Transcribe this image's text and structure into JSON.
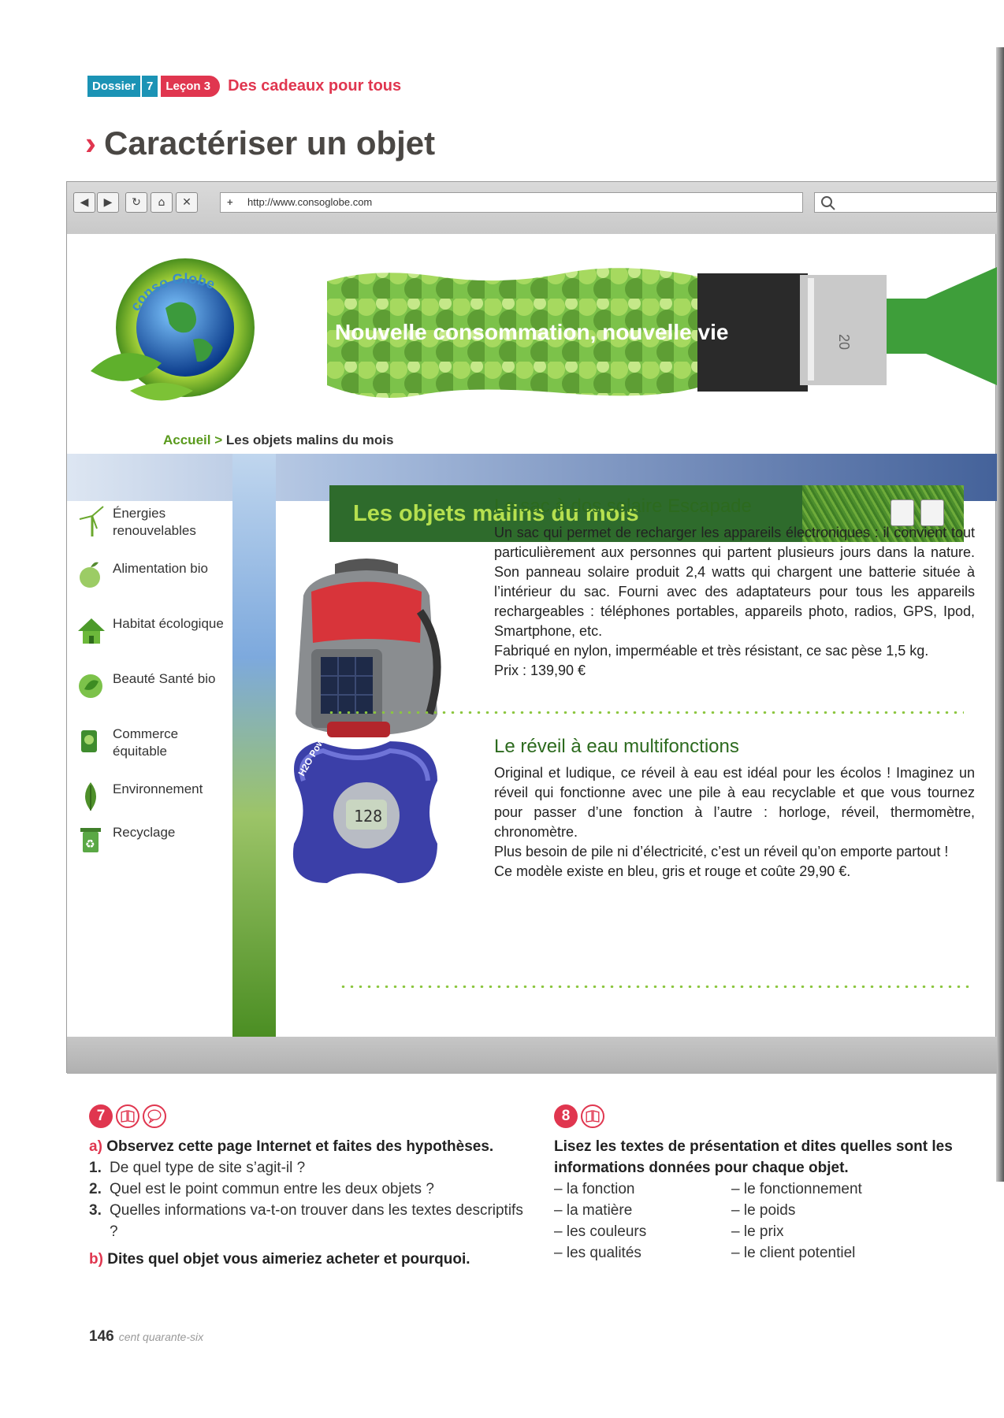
{
  "header": {
    "dossier_label": "Dossier",
    "dossier_num": "7",
    "lecon_label": "Leçon 3",
    "subtitle": "Des cadeaux pour tous"
  },
  "page_title": "Caractériser un objet",
  "browser": {
    "url": "http://www.consoglobe.com",
    "url_plus": "+"
  },
  "site": {
    "logo_text": "conso Globe",
    "banner_text": "Nouvelle consommation, nouvelle vie",
    "brush_text": "20",
    "breadcrumb": {
      "home": "Accueil",
      "sep": ">",
      "current": "Les objets malins du mois"
    },
    "section_title": "Les objets malins du mois",
    "nav": [
      {
        "label": "Énergies renouvelables",
        "icon": "wind-turbine-icon",
        "color": "#6ba82e"
      },
      {
        "label": "Alimentation bio",
        "icon": "apple-icon",
        "color": "#7cb342"
      },
      {
        "label": "Habitat écologique",
        "icon": "house-icon",
        "color": "#4c9a2a"
      },
      {
        "label": "Beauté Santé bio",
        "icon": "leaf-circle-icon",
        "color": "#63a63a"
      },
      {
        "label": "Commerce équitable",
        "icon": "fair-trade-icon",
        "color": "#3f8c2e"
      },
      {
        "label": "Environnement",
        "icon": "leaf-icon",
        "color": "#4e8f2a"
      },
      {
        "label": "Recyclage",
        "icon": "recycle-bin-icon",
        "color": "#5aa845"
      }
    ],
    "products": [
      {
        "title": "Le sac à dos solaire Escapade",
        "paragraphs": [
          "Un sac qui permet de recharger les appareils électroniques : il convient tout particulièrement aux personnes qui partent plusieurs jours dans la nature. Son panneau solaire produit 2,4 watts qui chargent une batterie située à l’intérieur du sac. Fourni avec des adaptateurs pour tous les appareils rechargeables : téléphones portables, appareils photo, radios, GPS, Ipod, Smartphone, etc.",
          "Fabriqué en nylon, imperméable et très résistant, ce sac pèse 1,5 kg.",
          "Prix : 139,90 €"
        ]
      },
      {
        "title": "Le réveil à eau multifonctions",
        "paragraphs": [
          "Original et ludique, ce réveil à eau est idéal pour les écolos ! Imaginez un réveil qui fonctionne avec une pile à eau recyclable et que vous tournez pour passer d’une fonction à l’autre : horloge, réveil, thermomètre, chronomètre.",
          "Plus besoin de pile ni d’électricité, c’est un réveil qu’on emporte partout !",
          "Ce modèle existe en bleu, gris et rouge et coûte 29,90 €."
        ],
        "clock_display": "128",
        "clock_brand": "H2O Power"
      }
    ]
  },
  "exercise7": {
    "number": "7",
    "a_label": "a)",
    "a_text": "Observez cette page Internet et faites des hypothèses.",
    "questions": [
      {
        "num": "1.",
        "text": "De quel type de site s’agit-il ?"
      },
      {
        "num": "2.",
        "text": "Quel est le point commun entre les deux objets ?"
      },
      {
        "num": "3.",
        "text": "Quelles informations va-t-on trouver dans les textes descriptifs ?"
      }
    ],
    "b_label": "b)",
    "b_text": "Dites quel objet vous aimeriez acheter et pourquoi."
  },
  "exercise8": {
    "number": "8",
    "instruction": "Lisez les textes de présentation et dites quelles sont les informations données pour chaque objet.",
    "col1": [
      "– la fonction",
      "– la matière",
      "– les couleurs",
      "– les qualités"
    ],
    "col2": [
      "– le fonctionnement",
      "– le poids",
      "– le prix",
      "– le client potentiel"
    ]
  },
  "footer": {
    "page_number": "146",
    "page_words": "cent quarante-six"
  },
  "colors": {
    "accent_red": "#e0364f",
    "accent_blue": "#1b93b5",
    "site_green": "#2e6b2c"
  }
}
